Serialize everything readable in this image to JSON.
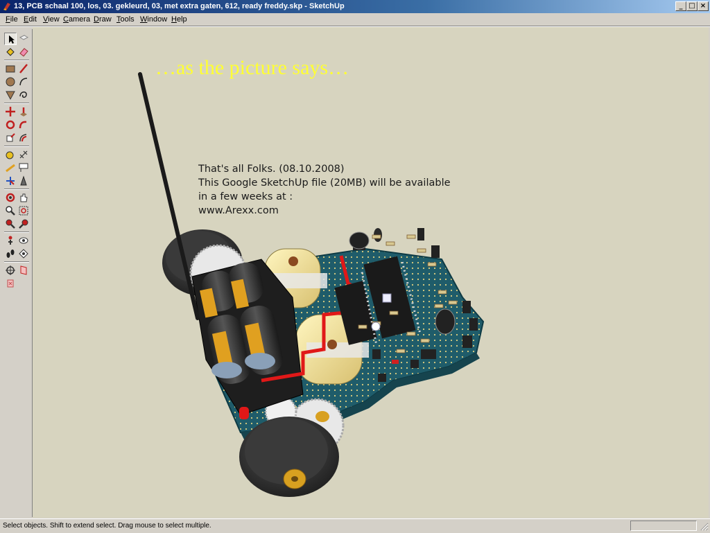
{
  "window": {
    "title": "13, PCB schaal 100, los, 03. gekleurd, 03, met extra gaten, 612, ready freddy.skp - SketchUp",
    "minimize": "_",
    "maximize": "□",
    "close": "×"
  },
  "menu": [
    {
      "label_u": "F",
      "label_rest": "ile"
    },
    {
      "label_u": "E",
      "label_rest": "dit"
    },
    {
      "label_u": "V",
      "label_rest": "iew"
    },
    {
      "label_u": "C",
      "label_rest": "amera"
    },
    {
      "label_u": "D",
      "label_rest": "raw"
    },
    {
      "label_u": "T",
      "label_rest": "ools"
    },
    {
      "label_u": "W",
      "label_rest": "indow"
    },
    {
      "label_u": "H",
      "label_rest": "elp"
    }
  ],
  "toolbar": {
    "tools": [
      "select-tool-icon",
      "make-component-icon",
      "paint-bucket-icon",
      "eraser-icon",
      "rectangle-icon",
      "line-icon",
      "circle-icon",
      "arc-icon",
      "polygon-icon",
      "freehand-icon",
      "move-icon",
      "push-pull-icon",
      "rotate-icon",
      "follow-me-icon",
      "scale-icon",
      "offset-icon",
      "tape-measure-icon",
      "dimension-icon",
      "protractor-icon",
      "text-icon",
      "axes-icon",
      "3d-text-icon",
      "orbit-icon",
      "pan-icon",
      "zoom-icon",
      "zoom-window-icon",
      "previous-view-icon",
      "next-view-icon",
      "position-camera-icon",
      "look-around-icon",
      "walk-icon",
      "section-plane-icon",
      "zoom-extents-icon",
      "sandbox-icon",
      "section-cut-icon"
    ]
  },
  "viewport": {
    "heading": "…as the picture says…",
    "note_lines": [
      "That's all Folks. (08.10.2008)",
      "This Google SketchUp file (20MB) will be available",
      "in a few weeks at :",
      "www.Arexx.com"
    ],
    "background_color": "#d7d4bf",
    "heading_color": "#ffff33"
  },
  "status": {
    "text": "Select objects. Shift to extend select. Drag mouse to select multiple.",
    "measurements_value": ""
  }
}
